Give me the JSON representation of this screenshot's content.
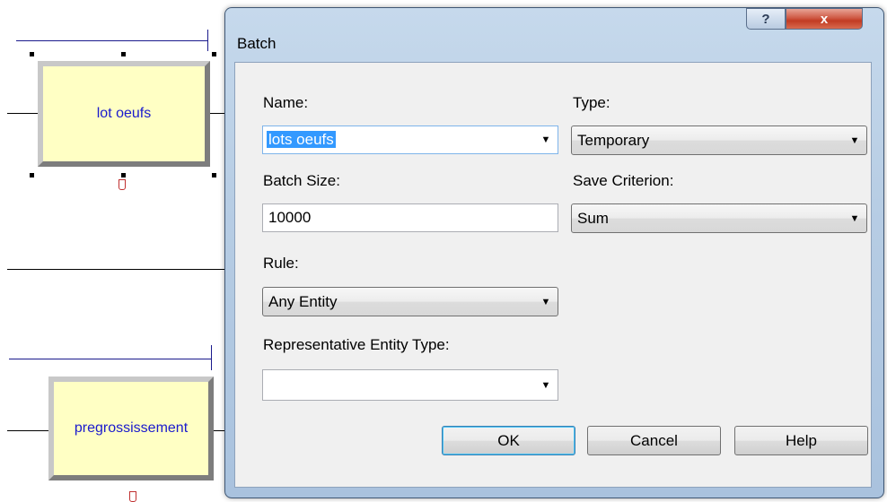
{
  "canvas": {
    "module1": {
      "label": "lot oeufs"
    },
    "module2": {
      "label": "pregrossissement"
    }
  },
  "dialog": {
    "title": "Batch",
    "help_glyph": "?",
    "close_glyph": "x",
    "name": {
      "label": "Name:",
      "value": "lots oeufs"
    },
    "type": {
      "label": "Type:",
      "value": "Temporary"
    },
    "batch_size": {
      "label": "Batch Size:",
      "value": "10000"
    },
    "save_criterion": {
      "label": "Save Criterion:",
      "value": "Sum"
    },
    "rule": {
      "label": "Rule:",
      "value": "Any Entity"
    },
    "rep_entity_type": {
      "label": "Representative Entity Type:",
      "value": ""
    },
    "buttons": {
      "ok": "OK",
      "cancel": "Cancel",
      "help": "Help"
    }
  },
  "colors": {
    "module_fill": "#ffffc4",
    "module_text": "#1a1acd",
    "selection": "#3399ff",
    "close_red": "#c23b22"
  },
  "icons": {
    "help": "question-mark-icon",
    "close": "close-icon",
    "dropdown": "triangle-down-icon"
  }
}
